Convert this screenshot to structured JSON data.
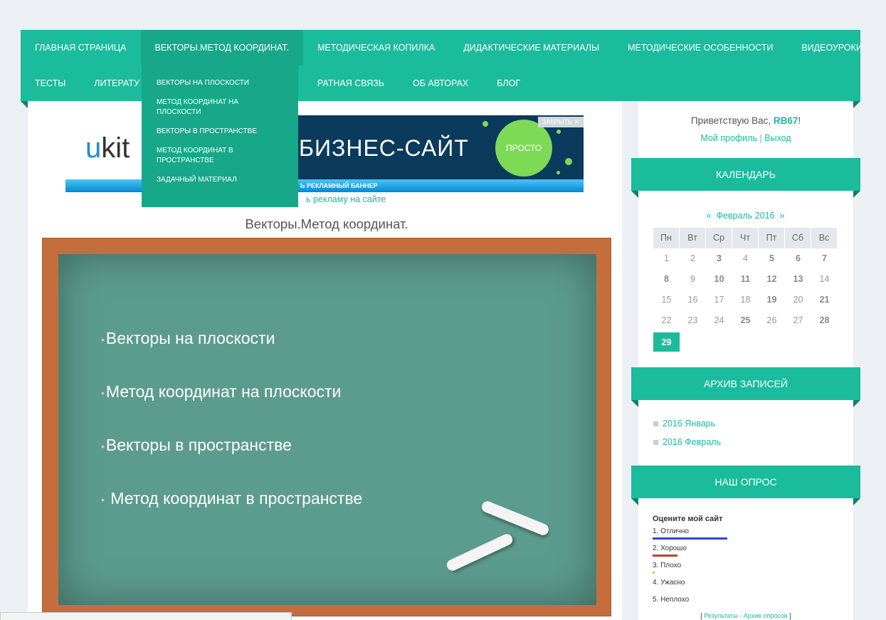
{
  "site": {
    "title_cut": ""
  },
  "nav": {
    "row1": [
      "ГЛАВНАЯ СТРАНИЦА",
      "ВЕКТОРЫ.МЕТОД КООРДИНАТ.",
      "МЕТОДИЧЕСКАЯ КОПИЛКА",
      "ДИДАКТИЧЕСКИЕ МАТЕРИАЛЫ",
      "МЕТОДИЧЕСКИЕ ОСОБЕННОСТИ",
      "ВИДЕОУРОКИ"
    ],
    "row2": [
      "ТЕСТЫ",
      "ЛИТЕРАТУ",
      "",
      "РАТНАЯ СВЯЗЬ",
      "ОБ АВТОРАХ",
      "БЛОГ"
    ]
  },
  "dropdown": [
    "ВЕКТОРЫ НА ПЛОСКОСТИ",
    "МЕТОД КООРДИНАТ НА ПЛОСКОСТИ",
    "ВЕКТОРЫ В ПРОСТРАНСТВЕ",
    "МЕТОД КООРДИНАТ В ПРОСТРАНСТВЕ",
    "ЗАДАЧНЫЙ МАТЕРИАЛ"
  ],
  "banner": {
    "logo_u": "u",
    "logo_rest": "kit",
    "headline": "БИЗНЕС-САЙТ",
    "circle": "ПРОСТО",
    "close": "ЗАКРЫТЬ ✕",
    "bar_text": "Ь РЕКЛАМНЫЙ БАННЕР",
    "link": "ь рекламу на сайте"
  },
  "page_title": "Векторы.Метод координат.",
  "board": {
    "lines": [
      "Векторы на плоскости",
      "Метод координат на плоскости",
      "Векторы в пространстве",
      " Метод координат в пространстве"
    ],
    "bullet": "•"
  },
  "statusbar": "",
  "greeting": {
    "prefix": "Приветствую Вас, ",
    "user": "RB67",
    "suffix": "!",
    "profile": "Мой профиль",
    "sep": " | ",
    "logout": "Выход"
  },
  "calendar": {
    "title": "КАЛЕНДАРЬ",
    "prev": "«",
    "month": "Февраль 2016",
    "next": "»",
    "weekdays": [
      "Пн",
      "Вт",
      "Ср",
      "Чт",
      "Пт",
      "Сб",
      "Вс"
    ],
    "weeks": [
      [
        {
          "d": "1"
        },
        {
          "d": "2"
        },
        {
          "d": "3",
          "b": true
        },
        {
          "d": "4"
        },
        {
          "d": "5",
          "b": true
        },
        {
          "d": "6",
          "b": true
        },
        {
          "d": "7",
          "b": true
        }
      ],
      [
        {
          "d": "8",
          "b": true
        },
        {
          "d": "9"
        },
        {
          "d": "10",
          "b": true
        },
        {
          "d": "11",
          "b": true
        },
        {
          "d": "12",
          "b": true
        },
        {
          "d": "13",
          "b": true
        },
        {
          "d": "14"
        }
      ],
      [
        {
          "d": "15"
        },
        {
          "d": "16"
        },
        {
          "d": "17"
        },
        {
          "d": "18"
        },
        {
          "d": "19",
          "b": true
        },
        {
          "d": "20"
        },
        {
          "d": "21",
          "b": true
        }
      ],
      [
        {
          "d": "22"
        },
        {
          "d": "23"
        },
        {
          "d": "24"
        },
        {
          "d": "25",
          "b": true
        },
        {
          "d": "26"
        },
        {
          "d": "27"
        },
        {
          "d": "28",
          "b": true
        }
      ],
      [
        {
          "d": "29",
          "today": true
        }
      ]
    ],
    "accent": "#1abc9c"
  },
  "archive": {
    "title": "АРХИВ ЗАПИСЕЙ",
    "items": [
      "2016 Январь",
      "2016 Февраль"
    ]
  },
  "poll": {
    "title": "НАШ ОПРОС",
    "question": "Оцените мой сайт",
    "options": [
      {
        "label": "1. Отлично",
        "color": "#3548c8",
        "share": 1.0
      },
      {
        "label": "2. Хорошо",
        "color": "#b5472a",
        "share": 0.33
      },
      {
        "label": "3. Плохо",
        "color": "#d4c34a",
        "share": 0.03
      },
      {
        "label": "4. Ужасно",
        "color": "#ffffff",
        "share": 0
      },
      {
        "label": "5. Неплохо",
        "color": "#ffffff",
        "share": 0
      }
    ],
    "results": "Результаты",
    "dot": "·",
    "archive": "Архив опросов",
    "open": "[",
    "close": "]"
  }
}
